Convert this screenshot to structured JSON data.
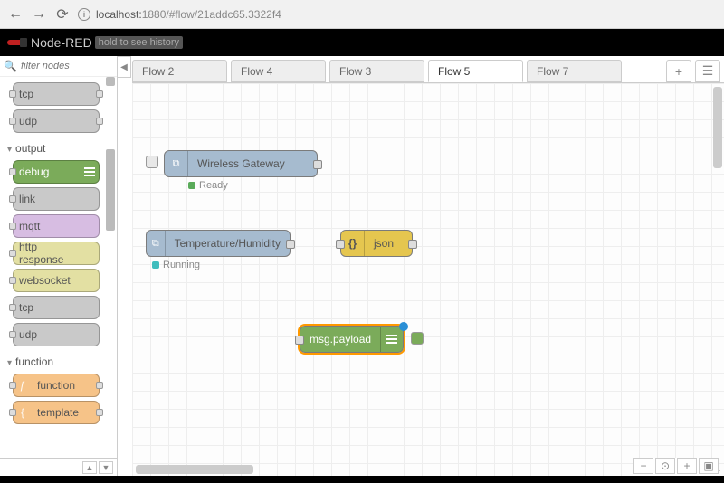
{
  "browser": {
    "url_host": "localhost:",
    "url_rest": "1880/#flow/21addc65.3322f4"
  },
  "app": {
    "title": "Node-RED",
    "hint": "hold to see history"
  },
  "palette": {
    "filter_placeholder": "filter nodes",
    "items_top": [
      {
        "label": "tcp",
        "cls": "c-gray",
        "port": "both"
      },
      {
        "label": "udp",
        "cls": "c-gray",
        "port": "both"
      }
    ],
    "cat_output": "output",
    "items_output": [
      {
        "label": "debug",
        "cls": "c-green",
        "port": "left",
        "iconSide": "right",
        "icon": "bars"
      },
      {
        "label": "link",
        "cls": "c-gray",
        "port": "left",
        "iconSide": "right"
      },
      {
        "label": "mqtt",
        "cls": "c-purple",
        "port": "left",
        "iconSide": "right"
      },
      {
        "label": "http response",
        "cls": "c-khaki",
        "port": "left",
        "iconSide": "right"
      },
      {
        "label": "websocket",
        "cls": "c-khaki",
        "port": "left",
        "iconSide": "right"
      },
      {
        "label": "tcp",
        "cls": "c-gray",
        "port": "left",
        "iconSide": "right"
      },
      {
        "label": "udp",
        "cls": "c-gray",
        "port": "left",
        "iconSide": "right"
      }
    ],
    "cat_function": "function",
    "items_function": [
      {
        "label": "function",
        "cls": "c-orange",
        "port": "both",
        "iconSide": "left",
        "iconChar": "ƒ"
      },
      {
        "label": "template",
        "cls": "c-orange",
        "port": "both",
        "iconSide": "left",
        "iconChar": "{"
      }
    ]
  },
  "tabs": [
    {
      "label": "Flow 2",
      "active": false
    },
    {
      "label": "Flow 4",
      "active": false
    },
    {
      "label": "Flow 3",
      "active": false
    },
    {
      "label": "Flow 5",
      "active": true
    },
    {
      "label": "Flow 7",
      "active": false
    }
  ],
  "nodes": {
    "gw": {
      "label": "Wireless Gateway",
      "status": "Ready"
    },
    "th": {
      "label": "Temperature/Humidity",
      "status": "Running"
    },
    "json": {
      "label": "json"
    },
    "debug": {
      "label": "msg.payload"
    }
  }
}
